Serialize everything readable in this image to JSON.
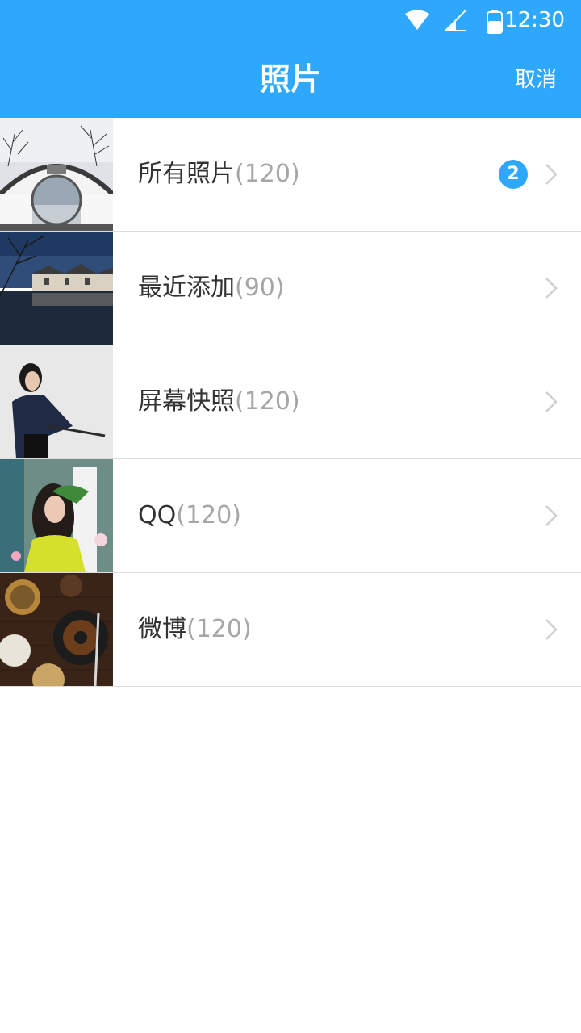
{
  "status_bar": {
    "time": "12:30",
    "icons": [
      "wifi-icon",
      "cellular-signal-icon",
      "battery-icon"
    ]
  },
  "nav": {
    "title": "照片",
    "cancel_label": "取消"
  },
  "colors": {
    "header_bg": "#2EA8FD",
    "badge_bg": "#2EA8FD",
    "name_text": "#333333",
    "count_text": "#A6A6A6",
    "divider": "#DDDDDD"
  },
  "albums": [
    {
      "name": "所有照片",
      "count": "(120)",
      "badge": "2"
    },
    {
      "name": "最近添加",
      "count": "(90)"
    },
    {
      "name": "屏幕快照",
      "count": "(120)"
    },
    {
      "name": "QQ",
      "count": "(120)"
    },
    {
      "name": "微博",
      "count": "(120)"
    }
  ]
}
